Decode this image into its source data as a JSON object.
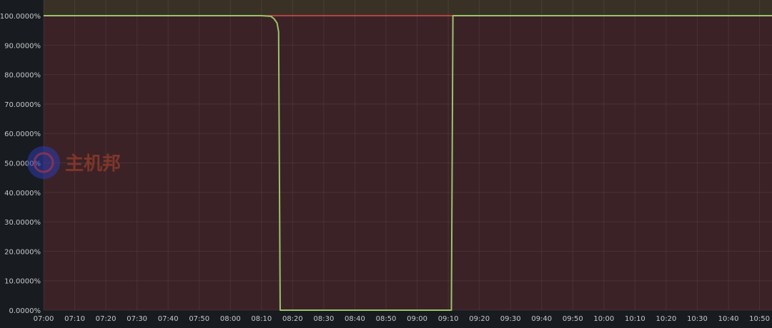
{
  "chart_data": {
    "type": "line",
    "title": "",
    "xlabel": "",
    "ylabel": "",
    "x_ticks": [
      "07:00",
      "07:10",
      "07:20",
      "07:30",
      "07:40",
      "07:50",
      "08:00",
      "08:10",
      "08:20",
      "08:30",
      "08:40",
      "08:50",
      "09:00",
      "09:10",
      "09:20",
      "09:30",
      "09:40",
      "09:50",
      "10:00",
      "10:10",
      "10:20",
      "10:30",
      "10:40",
      "10:50"
    ],
    "y_ticks": [
      "0.0000%",
      "10.0000%",
      "20.0000%",
      "30.0000%",
      "40.0000%",
      "50.0000%",
      "60.0000%",
      "70.0000%",
      "80.0000%",
      "90.0000%",
      "100.0000%"
    ],
    "xlim": [
      "07:00",
      "10:54"
    ],
    "ylim": [
      0,
      100
    ],
    "grid": true,
    "threshold": {
      "value": 100,
      "color": "#e0484f",
      "below_fill": "#3b2227",
      "above_fill": "#3a3126"
    },
    "series": [
      {
        "color": "#9ac46a",
        "points": [
          {
            "x": "07:00",
            "y": 100
          },
          {
            "x": "08:10",
            "y": 100
          },
          {
            "x": "08:13",
            "y": 99.8
          },
          {
            "x": "08:14",
            "y": 99.0
          },
          {
            "x": "08:15",
            "y": 97.5
          },
          {
            "x": "08:15:30",
            "y": 94.5
          },
          {
            "x": "08:16",
            "y": 0
          },
          {
            "x": "09:11",
            "y": 0
          },
          {
            "x": "09:11:30",
            "y": 100
          },
          {
            "x": "10:54",
            "y": 100
          }
        ]
      }
    ]
  },
  "watermark": {
    "text": "主机邦"
  }
}
